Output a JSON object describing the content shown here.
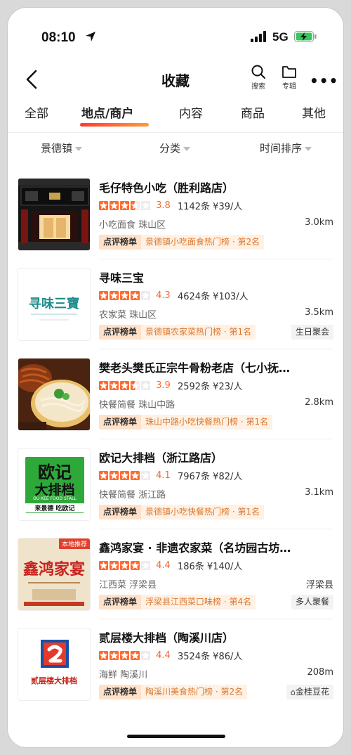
{
  "status_bar": {
    "time": "08:10",
    "network": "5G"
  },
  "header": {
    "title": "收藏",
    "search_label": "搜索",
    "album_label": "专辑"
  },
  "tabs": [
    {
      "label": "全部"
    },
    {
      "label": "地点/商户",
      "active": true
    },
    {
      "label": "内容"
    },
    {
      "label": "商品"
    },
    {
      "label": "其他"
    }
  ],
  "filters": {
    "city": "景德镇",
    "category": "分类",
    "sort": "时间排序"
  },
  "colors": {
    "accent": "#ff6a2e",
    "star": "#ff6a2e",
    "rank_badge_bg": "#ffe0c9"
  },
  "items": [
    {
      "name": "毛仔特色小吃（胜利路店）",
      "rating": 3.5,
      "score": "3.8",
      "reviews": "1142条 ¥39/人",
      "meta": "小吃面食 珠山区",
      "distance": "3.0km",
      "rank_badge": "点评榜单",
      "rank_text": "景德镇小吃面食热门榜 · 第2名",
      "extra_tag": "",
      "thumb_icon": "restaurant-storefront-photo"
    },
    {
      "name": "寻味三宝",
      "rating": 4.0,
      "score": "4.3",
      "reviews": "4624条 ¥103/人",
      "meta": "农家菜 珠山区",
      "distance": "3.5km",
      "rank_badge": "点评榜单",
      "rank_text": "景德镇农家菜热门榜 · 第1名",
      "extra_tag": "生日聚会",
      "thumb_logo": "寻味三寶"
    },
    {
      "name": "樊老头樊氏正宗牛骨粉老店（七小抚…",
      "rating": 3.5,
      "score": "3.9",
      "reviews": "2592条 ¥23/人",
      "meta": "快餐简餐 珠山中路",
      "distance": "2.8km",
      "rank_badge": "点评榜单",
      "rank_text": "珠山中路小吃快餐热门榜 · 第1名",
      "extra_tag": "",
      "thumb_icon": "noodle-bowl-photo"
    },
    {
      "name": "欧记大排档（浙江路店）",
      "rating": 4.0,
      "score": "4.1",
      "reviews": "7967条 ¥82/人",
      "meta": "快餐简餐 浙江路",
      "distance": "3.1km",
      "rank_badge": "点评榜单",
      "rank_text": "景德镇小吃快餐热门榜 · 第1名",
      "extra_tag": "",
      "thumb_logo_line1": "欧记",
      "thumb_logo_line2": "大排档",
      "thumb_logo_sub": "OU KEE FOOD STALL",
      "thumb_logo_slogan": "来景德 吃欧记"
    },
    {
      "name": "鑫鸿家宴 · 非遗农家菜（名坊园古坊…",
      "rating": 4.0,
      "score": "4.4",
      "reviews": "186条 ¥140/人",
      "meta": "江西菜 浮梁县",
      "distance": "浮梁县",
      "rank_badge": "点评榜单",
      "rank_text": "浮梁县江西菜口味榜 · 第4名",
      "extra_tag": "多人聚餐",
      "thumb_badge": "本地推荐",
      "thumb_logo": "鑫鸿家宴"
    },
    {
      "name": "贰层楼大排档（陶溪川店）",
      "rating": 4.0,
      "score": "4.4",
      "reviews": "3524条 ¥86/人",
      "meta": "海鲜 陶溪川",
      "distance": "208m",
      "rank_badge": "点评榜单",
      "rank_text": "陶溪川美食热门榜 · 第2名",
      "extra_tag": "金桂豆花",
      "thumb_logo": "贰层楼大排档"
    }
  ]
}
